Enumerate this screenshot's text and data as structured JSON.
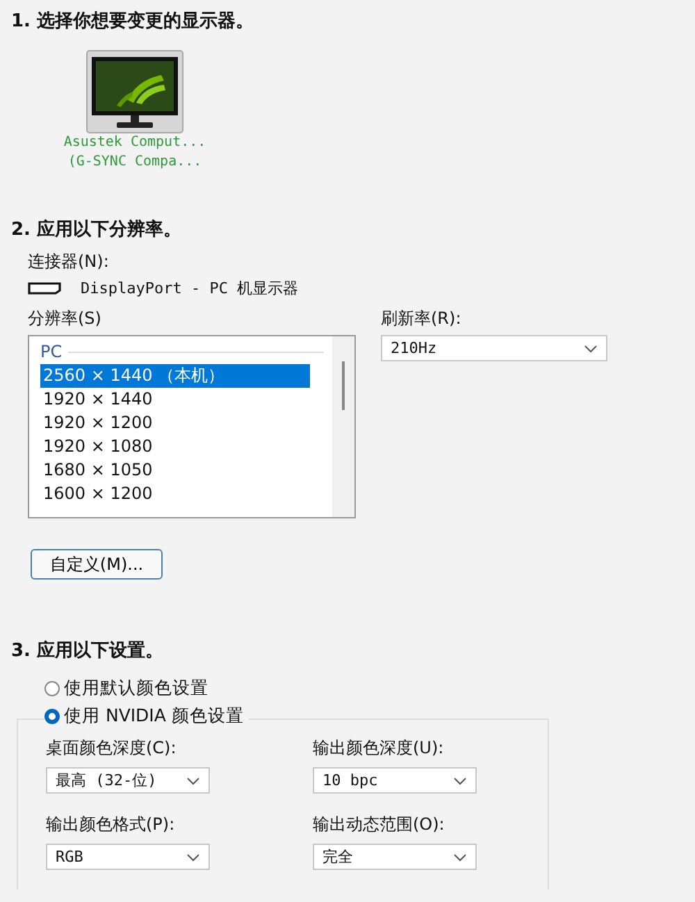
{
  "section_1": {
    "heading": "1. 选择你想要变更的显示器。",
    "displays": [
      {
        "name": "Asustek Comput...",
        "detail": "(G-SYNC Compa...",
        "selected": true
      }
    ]
  },
  "section_2": {
    "heading": "2. 应用以下分辨率。",
    "connector_label": "连接器(N):",
    "connector": "DisplayPort - PC 机显示器",
    "resolution_label": "分辨率(S)",
    "resolution_group": "PC",
    "resolutions": [
      {
        "label": "2560 × 1440 （本机）",
        "selected": true
      },
      {
        "label": "1920 × 1440",
        "selected": false
      },
      {
        "label": "1920 × 1200",
        "selected": false
      },
      {
        "label": "1920 × 1080",
        "selected": false
      },
      {
        "label": "1680 × 1050",
        "selected": false
      },
      {
        "label": "1600 × 1200",
        "selected": false
      }
    ],
    "refresh_label": "刷新率(R):",
    "refresh_value": "210Hz",
    "custom_button": "自定义(M)..."
  },
  "section_3": {
    "heading": "3. 应用以下设置。",
    "color_modes": [
      {
        "label": "使用默认颜色设置",
        "selected": false
      },
      {
        "label": "使用 NVIDIA 颜色设置",
        "selected": true
      }
    ],
    "settings": [
      {
        "label": "桌面颜色深度(C):",
        "value": "最高 (32-位)"
      },
      {
        "label": "输出颜色深度(U):",
        "value": "10 bpc"
      },
      {
        "label": "输出颜色格式(P):",
        "value": "RGB"
      },
      {
        "label": "输出动态范围(O):",
        "value": "完全"
      }
    ]
  }
}
